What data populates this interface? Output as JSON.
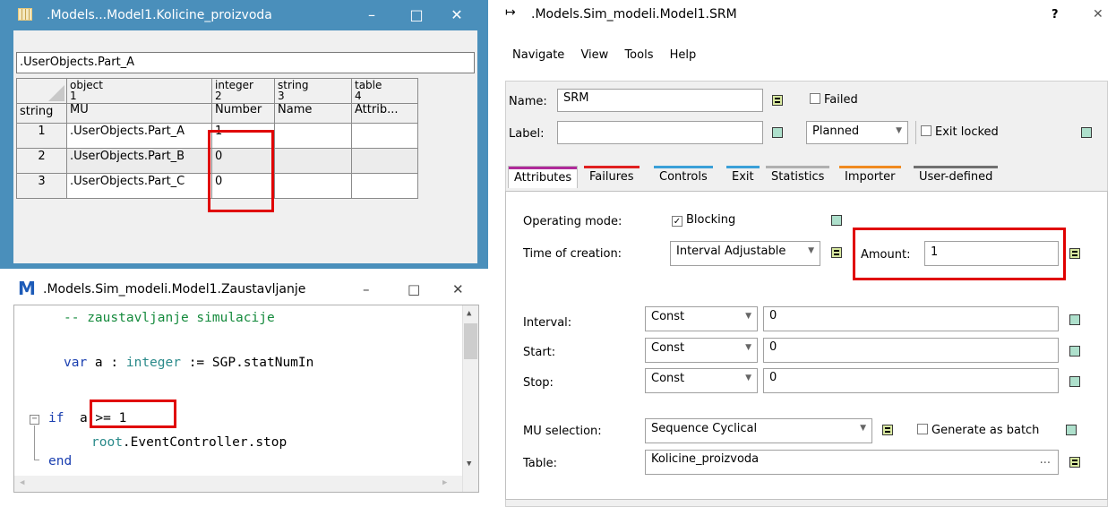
{
  "table_window": {
    "title": ".Models...Model1.Kolicine_proizvoda",
    "path": ".UserObjects.Part_A",
    "corner_label": "string",
    "columns": [
      {
        "type": "object",
        "index": "1",
        "name": "MU"
      },
      {
        "type": "integer",
        "index": "2",
        "name": "Number"
      },
      {
        "type": "string",
        "index": "3",
        "name": "Name"
      },
      {
        "type": "table",
        "index": "4",
        "name": "Attrib..."
      }
    ],
    "rows": [
      {
        "num": "1",
        "mu": ".UserObjects.Part_A",
        "number": "1"
      },
      {
        "num": "2",
        "mu": ".UserObjects.Part_B",
        "number": "0"
      },
      {
        "num": "3",
        "mu": ".UserObjects.Part_C",
        "number": "0"
      }
    ],
    "buttons": {
      "minimize": "–",
      "maximize": "□",
      "close": "✕"
    }
  },
  "code_window": {
    "title": ".Models.Sim_modeli.Model1.Zaustavljanje",
    "icon_letter": "M",
    "lines": {
      "comment": "-- zaustavljanje simulacije",
      "var_kw": "var",
      "var_name": " a : ",
      "var_type": "integer",
      "var_rest": " := SGP.statNumIn",
      "if_kw": "if",
      "if_cond": "a >= 1",
      "stop_obj": "root",
      "stop_rest": ".EventController.stop",
      "end_kw": "end"
    },
    "buttons": {
      "minimize": "–",
      "maximize": "□",
      "close": "✕"
    }
  },
  "srm_window": {
    "title": ".Models.Sim_modeli.Model1.SRM",
    "help": "?",
    "close": "✕",
    "menu": [
      "Navigate",
      "View",
      "Tools",
      "Help"
    ],
    "name_label": "Name:",
    "name_value": "SRM",
    "failed_label": "Failed",
    "label_label": "Label:",
    "label_value": "",
    "planned_value": "Planned",
    "exit_locked_label": "Exit locked",
    "tabs": [
      "Attributes",
      "Failures",
      "Controls",
      "Exit",
      "Statistics",
      "Importer",
      "User-defined"
    ],
    "tab_colors": [
      "#b02a9a",
      "#e02020",
      "#3aa0d8",
      "#3aa0d8",
      "#b0b0b0",
      "#f08a20",
      "#707070"
    ],
    "attributes": {
      "operating_mode_label": "Operating mode:",
      "blocking_label": "Blocking",
      "time_of_creation_label": "Time of creation:",
      "time_of_creation_value": "Interval Adjustable",
      "amount_label": "Amount:",
      "amount_value": "1",
      "interval_label": "Interval:",
      "interval_type": "Const",
      "interval_value": "0",
      "start_label": "Start:",
      "start_type": "Const",
      "start_value": "0",
      "stop_label": "Stop:",
      "stop_type": "Const",
      "stop_value": "0",
      "mu_selection_label": "MU selection:",
      "mu_selection_value": "Sequence Cyclical",
      "generate_batch_label": "Generate as batch",
      "table_label": "Table:",
      "table_value": "Kolicine_proizvoda",
      "table_browse": "..."
    }
  }
}
